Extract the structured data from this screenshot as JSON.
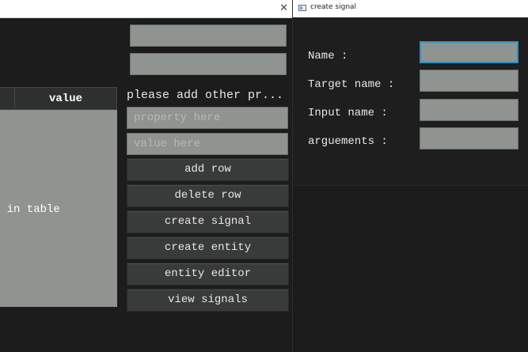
{
  "main_window": {
    "close_glyph": "✕",
    "table": {
      "header_value": "value",
      "body_text": "ent in table"
    },
    "properties_heading": "please add other pr...",
    "inputs": {
      "property_placeholder": "property here",
      "value_placeholder": "value here"
    },
    "buttons": {
      "add_row": "add row",
      "delete_row": "delete row",
      "create_signal": "create signal",
      "create_entity": "create entity",
      "entity_editor": "entity editor",
      "view_signals": "view signals"
    }
  },
  "dialog": {
    "title": "create signal",
    "labels": {
      "name": "Name :",
      "target_name": "Target name :",
      "input_name": "Input name :",
      "arguments": "arguements :"
    },
    "values": {
      "name": "",
      "target_name": "",
      "input_name": "",
      "arguments": ""
    }
  },
  "colors": {
    "background": "#1b1b1b",
    "field": "#8f9490",
    "button": "#393b3a",
    "focus": "#2f8fc4"
  }
}
